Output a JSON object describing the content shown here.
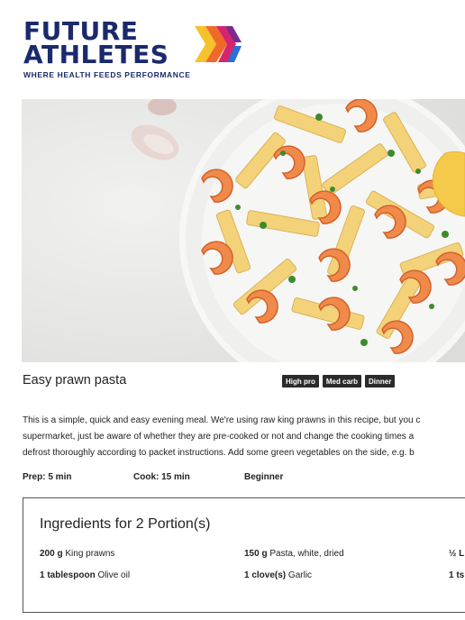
{
  "brand": {
    "line1": "FUTURE",
    "line2": "ATHLETES",
    "tagline": "WHERE HEALTH FEEDS PERFORMANCE",
    "colors": {
      "navy": "#1b2a6b",
      "yellow": "#f6c22b",
      "orange": "#ef6a2a",
      "magenta": "#d6246e",
      "purple": "#7b2b8e",
      "blue": "#2a6fd6"
    }
  },
  "hero_image": {
    "subject": "plate of penne pasta with king prawns and garlic cloves"
  },
  "recipe": {
    "title": "Easy prawn pasta",
    "tags": [
      "High pro",
      "Med carb",
      "Dinner"
    ],
    "description": [
      "This is a simple, quick and easy evening meal. We're using raw king prawns in this recipe, but you c",
      "supermarket, just be aware of whether they are pre-cooked or not and change the cooking times a",
      "defrost thoroughly according to packet instructions. Add some green vegetables on the side, e.g. b"
    ],
    "prep": "Prep: 5 min",
    "cook": "Cook: 15 min",
    "level": "Beginner"
  },
  "ingredients": {
    "heading": "Ingredients for 2 Portion(s)",
    "items": [
      {
        "qty": "200 g",
        "name": "King prawns"
      },
      {
        "qty": "150 g",
        "name": "Pasta, white, dried"
      },
      {
        "qty": "½ L",
        "name": ""
      },
      {
        "qty": "1 tablespoon",
        "name": "Olive oil"
      },
      {
        "qty": "1 clove(s)",
        "name": "Garlic"
      },
      {
        "qty": "1 ts",
        "name": ""
      }
    ]
  }
}
